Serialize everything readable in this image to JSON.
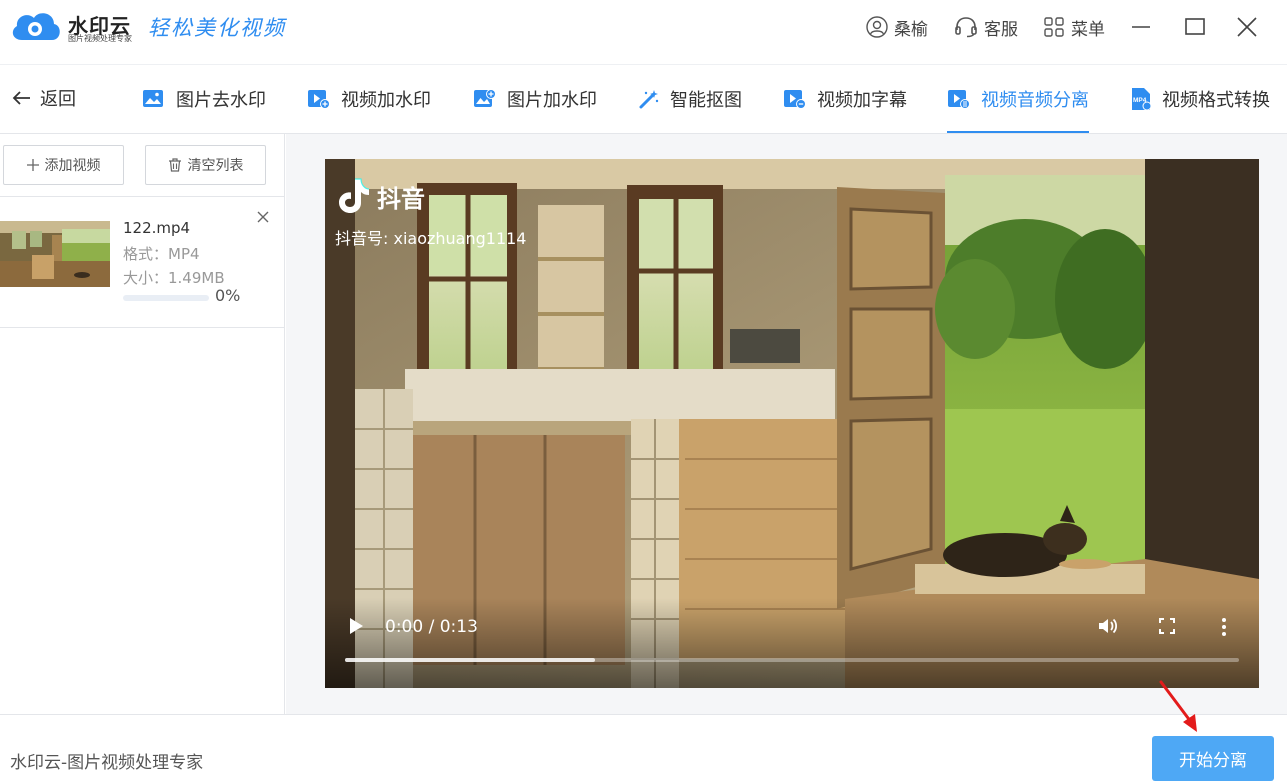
{
  "app": {
    "brand": "水印云",
    "brand_sub": "图片视频处理专家",
    "slogan": "轻松美化视频",
    "accent_color": "#2f8df0"
  },
  "titlebar": {
    "user_label": "桑榆",
    "service_label": "客服",
    "menu_label": "菜单",
    "icons": [
      "user-icon",
      "headset-icon",
      "grid-icon",
      "minimize-icon",
      "maximize-icon",
      "close-icon"
    ]
  },
  "nav": {
    "back_label": "返回",
    "tabs": [
      {
        "label": "图片去水印",
        "icon": "image-icon"
      },
      {
        "label": "视频加水印",
        "icon": "video-add-icon"
      },
      {
        "label": "图片加水印",
        "icon": "image-add-icon"
      },
      {
        "label": "智能抠图",
        "icon": "magic-wand-icon"
      },
      {
        "label": "视频加字幕",
        "icon": "video-subtitle-icon"
      },
      {
        "label": "视频音频分离",
        "icon": "video-audio-icon",
        "active": true
      },
      {
        "label": "视频格式转换",
        "icon": "mp4-icon"
      }
    ]
  },
  "leftpanel": {
    "add_label": "添加视频",
    "clear_label": "清空列表",
    "files": [
      {
        "name": "122.mp4",
        "format": "格式：MP4",
        "size": "大小：1.49MB",
        "progress_text": "0%",
        "progress": 0
      }
    ]
  },
  "video": {
    "tiktok_brand": "抖音",
    "tiktok_id": "抖音号: xiaozhuang1114",
    "time": "0:00 / 0:13",
    "seek_fraction": 0.28
  },
  "footer": {
    "text": "水印云-图片视频处理专家",
    "start_label": "开始分离"
  }
}
